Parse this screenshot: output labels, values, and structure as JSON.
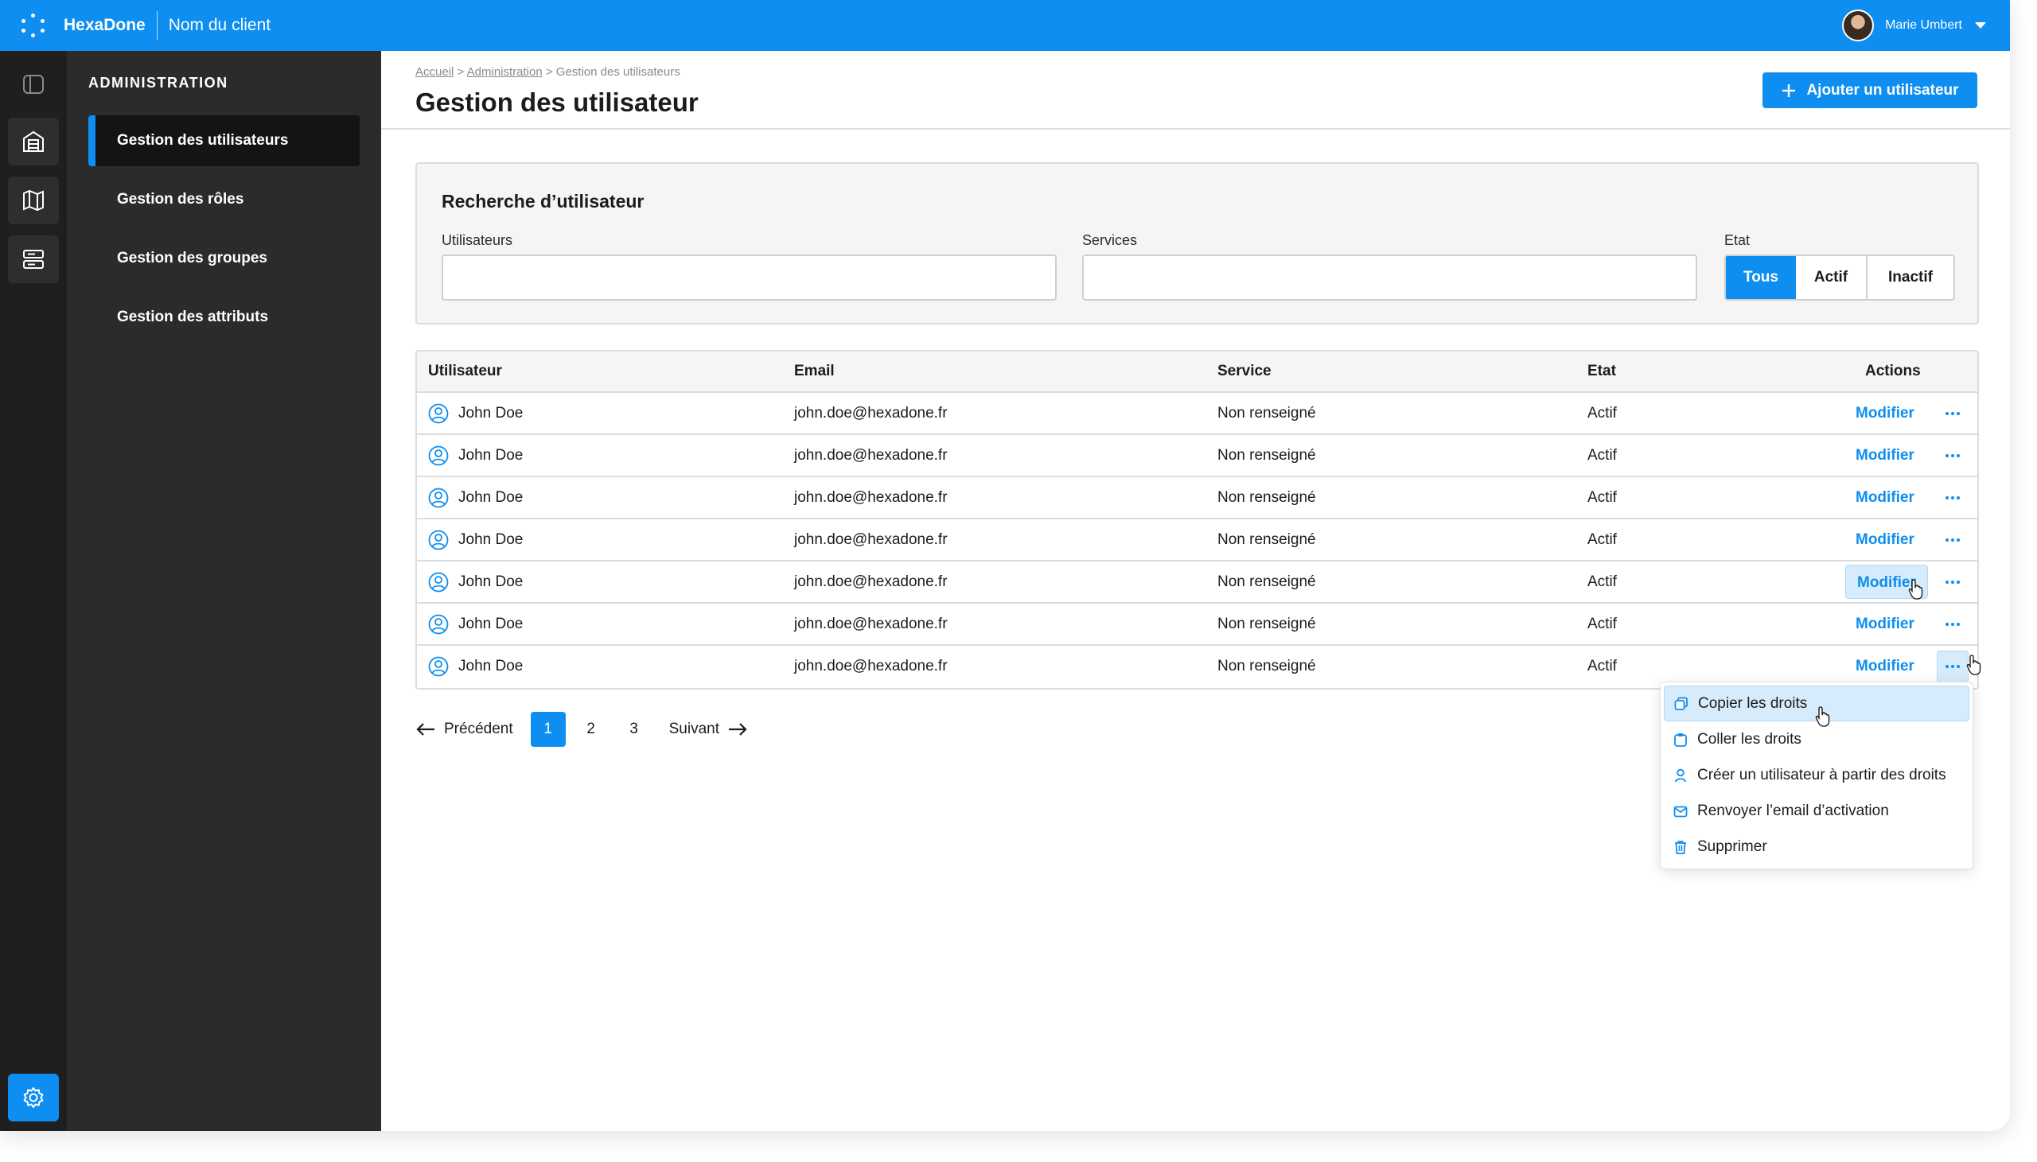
{
  "header": {
    "brand": "HexaDone",
    "client": "Nom du client",
    "user_name": "Marie Umbert",
    "accent_color": "#0d8ef0"
  },
  "rail": {
    "icons": [
      "sidebar-toggle-icon",
      "building-icon",
      "map-icon",
      "server-icon",
      "gear-icon"
    ]
  },
  "sidemenu": {
    "title": "ADMINISTRATION",
    "items": [
      {
        "label": "Gestion des utilisateurs",
        "active": true
      },
      {
        "label": "Gestion des rôles",
        "active": false
      },
      {
        "label": "Gestion des groupes",
        "active": false
      },
      {
        "label": "Gestion des attributs",
        "active": false
      }
    ]
  },
  "breadcrumb": {
    "home": "Accueil",
    "admin": "Administration",
    "current": "Gestion des utilisateurs",
    "sep": ">"
  },
  "page": {
    "title": "Gestion des utilisateur",
    "add_button": "Ajouter un utilisateur"
  },
  "search": {
    "title": "Recherche d’utilisateur",
    "users_label": "Utilisateurs",
    "users_value": "",
    "services_label": "Services",
    "services_value": "",
    "state_label": "Etat",
    "state_options": [
      "Tous",
      "Actif",
      "Inactif"
    ],
    "state_selected": "Tous"
  },
  "table": {
    "columns": [
      "Utilisateur",
      "Email",
      "Service",
      "Etat",
      "Actions"
    ],
    "action_label": "Modifier",
    "rows": [
      {
        "user": "John Doe",
        "email": "john.doe@hexadone.fr",
        "service": "Non renseigné",
        "state": "Actif"
      },
      {
        "user": "John Doe",
        "email": "john.doe@hexadone.fr",
        "service": "Non renseigné",
        "state": "Actif"
      },
      {
        "user": "John Doe",
        "email": "john.doe@hexadone.fr",
        "service": "Non renseigné",
        "state": "Actif"
      },
      {
        "user": "John Doe",
        "email": "john.doe@hexadone.fr",
        "service": "Non renseigné",
        "state": "Actif"
      },
      {
        "user": "John Doe",
        "email": "john.doe@hexadone.fr",
        "service": "Non renseigné",
        "state": "Actif"
      },
      {
        "user": "John Doe",
        "email": "john.doe@hexadone.fr",
        "service": "Non renseigné",
        "state": "Actif"
      },
      {
        "user": "John Doe",
        "email": "john.doe@hexadone.fr",
        "service": "Non renseigné",
        "state": "Actif"
      }
    ]
  },
  "pagination": {
    "prev": "Précédent",
    "next": "Suivant",
    "pages": [
      "1",
      "2",
      "3"
    ],
    "current": "1"
  },
  "context_menu": {
    "items": [
      {
        "label": "Copier les droits",
        "icon": "copy-icon"
      },
      {
        "label": "Coller les droits",
        "icon": "paste-icon"
      },
      {
        "label": "Créer un utilisateur à partir des droits",
        "icon": "user-icon"
      },
      {
        "label": "Renvoyer l’email d’activation",
        "icon": "mail-icon"
      },
      {
        "label": "Supprimer",
        "icon": "trash-icon"
      }
    ]
  }
}
